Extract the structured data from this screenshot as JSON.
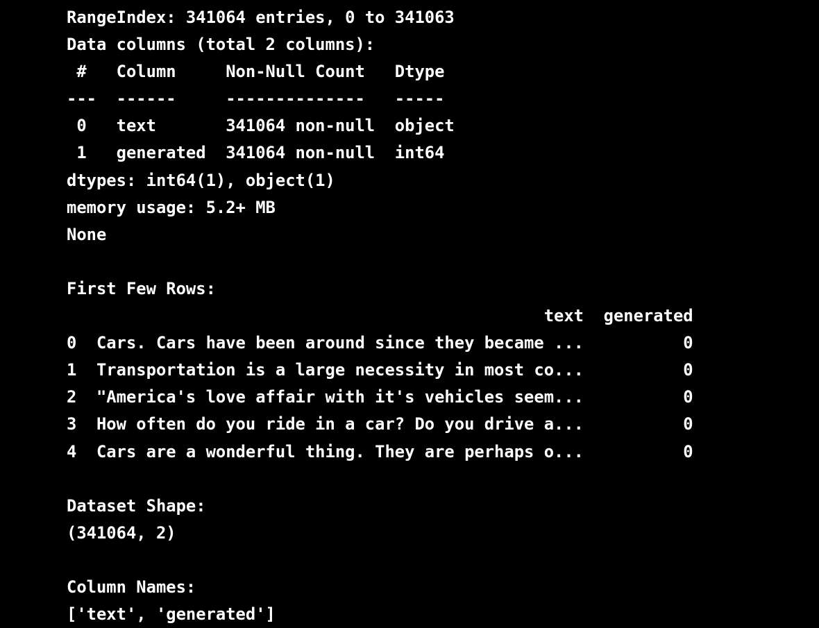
{
  "console": {
    "lines": [
      "RangeIndex: 341064 entries, 0 to 341063",
      "Data columns (total 2 columns):",
      " #   Column     Non-Null Count   Dtype ",
      "---  ------     --------------   ----- ",
      " 0   text       341064 non-null  object",
      " 1   generated  341064 non-null  int64 ",
      "dtypes: int64(1), object(1)",
      "memory usage: 5.2+ MB",
      "None",
      "",
      "First Few Rows:",
      "                                                text  generated",
      "0  Cars. Cars have been around since they became ...          0",
      "1  Transportation is a large necessity in most co...          0",
      "2  \"America's love affair with it's vehicles seem...          0",
      "3  How often do you ride in a car? Do you drive a...          0",
      "4  Cars are a wonderful thing. They are perhaps o...          0",
      "",
      "Dataset Shape:",
      "(341064, 2)",
      "",
      "Column Names:",
      "['text', 'generated']"
    ]
  }
}
